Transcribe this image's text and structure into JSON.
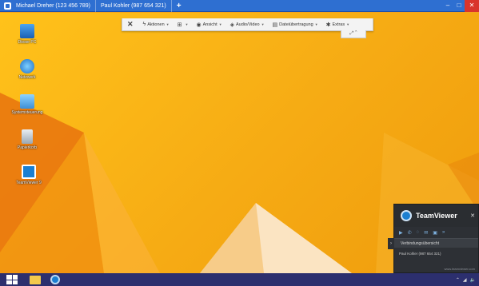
{
  "window": {
    "tabs": [
      {
        "label": "Michael Dreher (123 456 789)"
      },
      {
        "label": "Paul Kohler (987 654 321)"
      }
    ],
    "add_tab": "+",
    "controls": {
      "minimize": "–",
      "maximize": "□",
      "close": "✕"
    }
  },
  "toolbar": {
    "close": "✕",
    "items": [
      {
        "label": "Aktionen",
        "icon": "lightning-icon"
      },
      {
        "label": "",
        "icon": "windows-icon"
      },
      {
        "label": "Ansicht",
        "icon": "eye-icon"
      },
      {
        "label": "Audio/Video",
        "icon": "chat-icon"
      },
      {
        "label": "Dateiübertragung",
        "icon": "file-transfer-icon"
      },
      {
        "label": "Extras",
        "icon": "tools-icon"
      }
    ],
    "sub": "⤢ ⌃"
  },
  "desktop": {
    "icons": [
      {
        "label": "Dieser PC",
        "icon": "computer-icon"
      },
      {
        "label": "Netzwerk",
        "icon": "network-icon"
      },
      {
        "label": "Systemsteuerung",
        "icon": "control-panel-icon"
      },
      {
        "label": "Papierkorb",
        "icon": "recycle-bin-icon"
      },
      {
        "label": "TeamViewer 9",
        "icon": "teamviewer-icon"
      }
    ]
  },
  "teamviewer_panel": {
    "brand": "TeamViewer",
    "close": "✕",
    "section": "Verbindungsübersicht",
    "row": "Paul Kohler (987 654 321)",
    "footer": "www.teamviewer.com",
    "colors": {
      "accent": "#1b7fd1",
      "panel": "#2d3035"
    }
  },
  "taskbar": {
    "tray": [
      "⌃",
      "◢",
      "🔈"
    ]
  },
  "colors": {
    "titlebar": "#2e6fd1",
    "desktop": "#f6ab14",
    "taskbar": "#2c2f6e"
  }
}
